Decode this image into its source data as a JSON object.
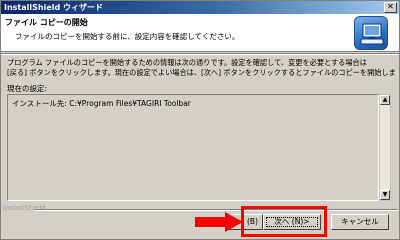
{
  "window": {
    "title": "InstallShield ウィザード",
    "close_glyph": "✕"
  },
  "header": {
    "title": "ファイル コピーの開始",
    "subtitle": "ファイルのコピーを開始する前に、設定内容を確認してください。",
    "logo_icon": "installshield-computer-icon"
  },
  "description": {
    "line1": "プログラム ファイルのコピーを開始するための情報は次の通りです。設定を確認して、変更を必要とする場合は",
    "line2": "[戻る] ボタンをクリックします。現在の設定でよい場合は、[次へ] ボタンをクリックするとファイルのコピーを開始します。"
  },
  "settings": {
    "label": "現在の設定:",
    "value": "インストール先: C:¥Program Files¥TAGIRI Toolbar"
  },
  "scrollbar": {
    "up_glyph": "▲",
    "down_glyph": "▼"
  },
  "footer": {
    "brand": "InstallShield"
  },
  "buttons": {
    "back_label": "(B)",
    "next_label": "次へ (N)>",
    "cancel_label": "キャンセル"
  },
  "annotation": {
    "highlight_color": "#ff0000"
  }
}
